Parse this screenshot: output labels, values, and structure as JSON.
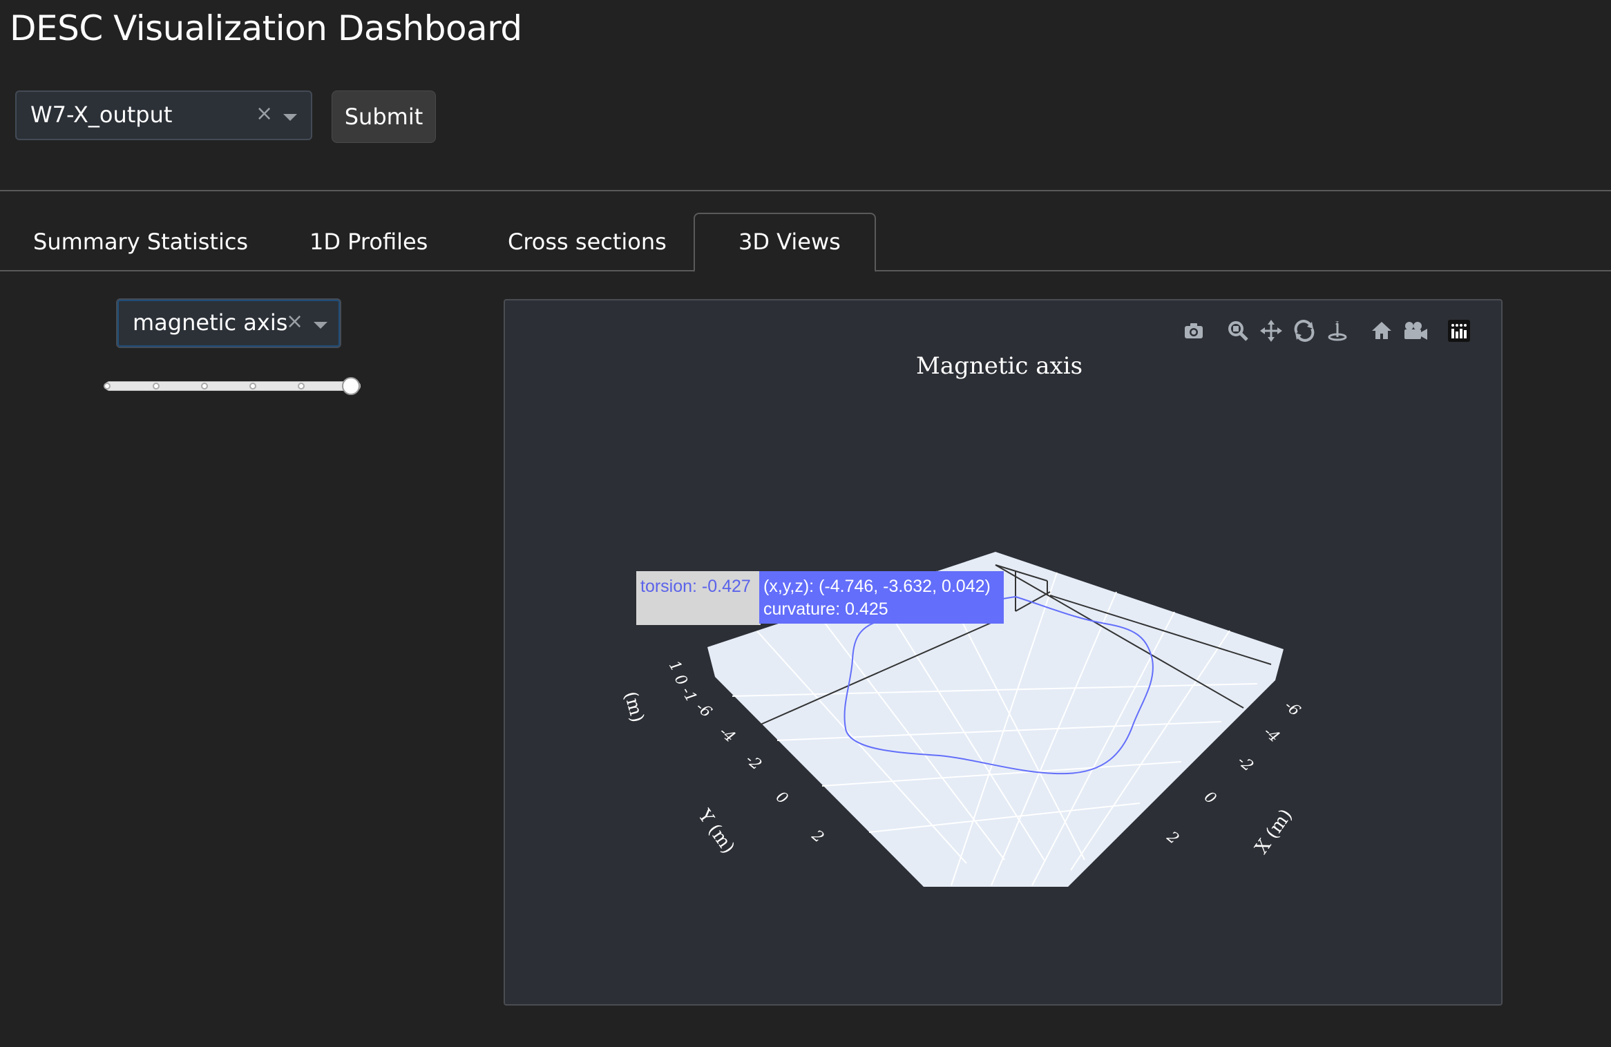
{
  "app": {
    "title": "DESC Visualization Dashboard"
  },
  "file_select": {
    "value": "W7-X_output",
    "clear_glyph": "×"
  },
  "submit_button": {
    "label": "Submit"
  },
  "tabs": [
    {
      "label": "Summary Statistics",
      "active": false
    },
    {
      "label": "1D Profiles",
      "active": false
    },
    {
      "label": "Cross sections",
      "active": false
    },
    {
      "label": "3D Views",
      "active": true
    }
  ],
  "view_select": {
    "value": "magnetic axis",
    "clear_glyph": "×"
  },
  "slider": {
    "marks": 6,
    "value_fraction": 1.0
  },
  "modebar": {
    "icons": [
      "camera-icon",
      "zoom-icon",
      "pan-icon",
      "orbit-rotation-icon",
      "turntable-rotation-icon",
      "home-icon",
      "camera-view-icon",
      "plotly-logo-icon"
    ]
  },
  "plot": {
    "title": "Magnetic axis",
    "hover": {
      "torsion": "torsion: -0.427",
      "xyz": "(x,y,z): (-4.746, -3.632, 0.042)",
      "curvature": "curvature: 0.425"
    },
    "axes": {
      "x_label": "X (m)",
      "y_label": "Y (m)",
      "z_label": "(m)",
      "x_ticks": [
        "-6",
        "-4",
        "-2",
        "0",
        "2"
      ],
      "y_ticks": [
        "-6",
        "-4",
        "-2",
        "0",
        "2"
      ],
      "z_ticks": [
        "1",
        "0",
        "-1"
      ]
    },
    "colors": {
      "curve": "#636efa",
      "floor": "#e5ecf6",
      "background": "#2c2f35"
    }
  }
}
